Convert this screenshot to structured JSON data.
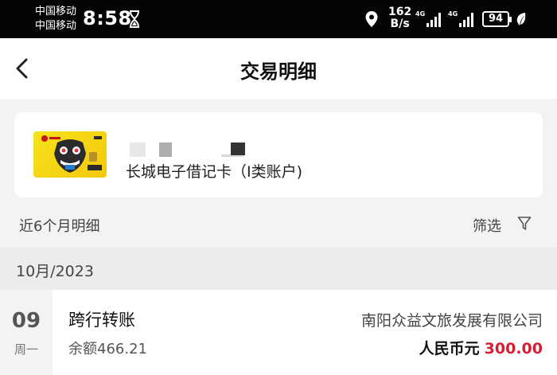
{
  "status_bar": {
    "carrier_1": "中国移动",
    "carrier_2": "中国移动",
    "time": "8:58",
    "speed_value": "162",
    "speed_unit": "B/s",
    "network_1": "4G",
    "network_2": "4G",
    "battery": "94"
  },
  "header": {
    "title": "交易明细"
  },
  "card": {
    "name": "长城电子借记卡（I类账户)"
  },
  "filter_bar": {
    "period_label": "近6个月明细",
    "filter_label": "筛选"
  },
  "month_label": "10月/2023",
  "transactions": [
    {
      "day": "09",
      "weekday": "周一",
      "type": "跨行转账",
      "balance": "余额466.21",
      "counterparty": "南阳众益文旅发展有限公司",
      "currency": "人民币元",
      "amount": "300.00"
    }
  ],
  "colors": {
    "status_bar_bg": "#050505",
    "amount": "#d51f35",
    "card_yellow": "#f7e31a",
    "page_bg": "#f3f3f4"
  },
  "icons": {
    "back": "chevron-left-icon",
    "filter": "funnel-icon",
    "hourglass": "hourglass-icon",
    "location": "location-pin-icon",
    "signal": "signal-bars-icon",
    "battery": "battery-icon",
    "leaf": "leaf-icon"
  }
}
